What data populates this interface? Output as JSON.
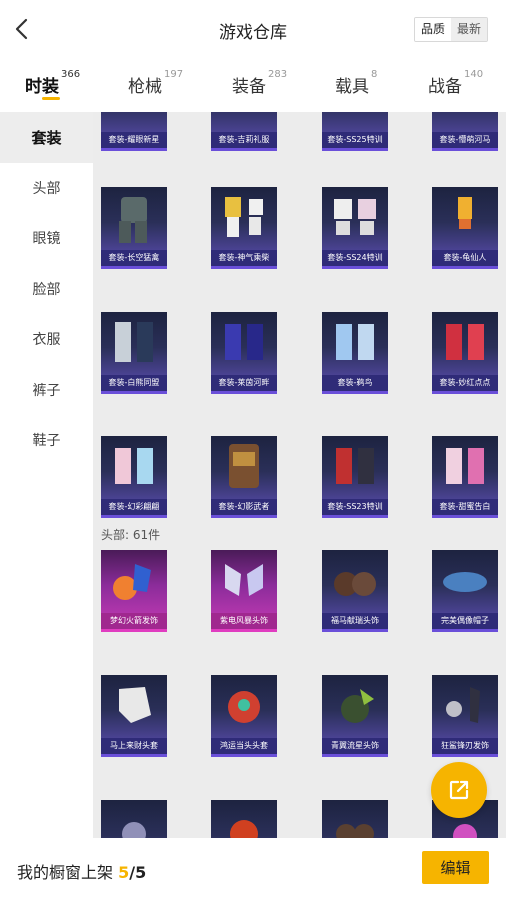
{
  "header": {
    "title": "游戏仓库",
    "sort_options": [
      "品质",
      "最新"
    ],
    "active_sort": 1
  },
  "tabs": [
    {
      "label": "时装",
      "count": "366"
    },
    {
      "label": "枪械",
      "count": "197"
    },
    {
      "label": "装备",
      "count": "283"
    },
    {
      "label": "载具",
      "count": "8"
    },
    {
      "label": "战备",
      "count": "140"
    }
  ],
  "sidebar": {
    "items": [
      {
        "label": "套装"
      },
      {
        "label": "头部"
      },
      {
        "label": "眼镜"
      },
      {
        "label": "脸部"
      },
      {
        "label": "衣服"
      },
      {
        "label": "裤子"
      },
      {
        "label": "鞋子"
      }
    ]
  },
  "outfits": {
    "rows": [
      [
        "套装-耀眼新星",
        "套装-吉莉礼服",
        "套装-SS25特训",
        "套装-懵萌河马"
      ],
      [
        "套装-长空猛禽",
        "套装-神气乘柴",
        "套装-SS24特训",
        "套装-龟仙人"
      ],
      [
        "套装-白熊同盟",
        "套装-莱茵河畔",
        "套装-鹈鸟",
        "套装-妙红点点"
      ],
      [
        "套装-幻彩翩翩",
        "套装-幻影武者",
        "套装-SS23特训",
        "套装-甜蜜告白"
      ]
    ]
  },
  "headwear": {
    "section_label": "头部: 61件",
    "rows": [
      [
        "梦幻火箭发饰",
        "紫电风暴头饰",
        "福马献瑞头饰",
        "完美偶像帽子"
      ],
      [
        "马上来财头套",
        "鸿运当头头套",
        "青翼流星头饰",
        "狂鲨锋刃发饰"
      ],
      [
        "",
        "",
        "",
        ""
      ]
    ]
  },
  "bottom": {
    "showcase_prefix": "我的橱窗上架 ",
    "showcase_count": "5",
    "showcase_sep": "/",
    "showcase_total": "5",
    "edit_label": "编辑"
  },
  "colors": {
    "accent": "#f6b400",
    "card_bg": "#2a2f58",
    "card_label": "#2f2b78",
    "card_pink": "#a0288f"
  }
}
